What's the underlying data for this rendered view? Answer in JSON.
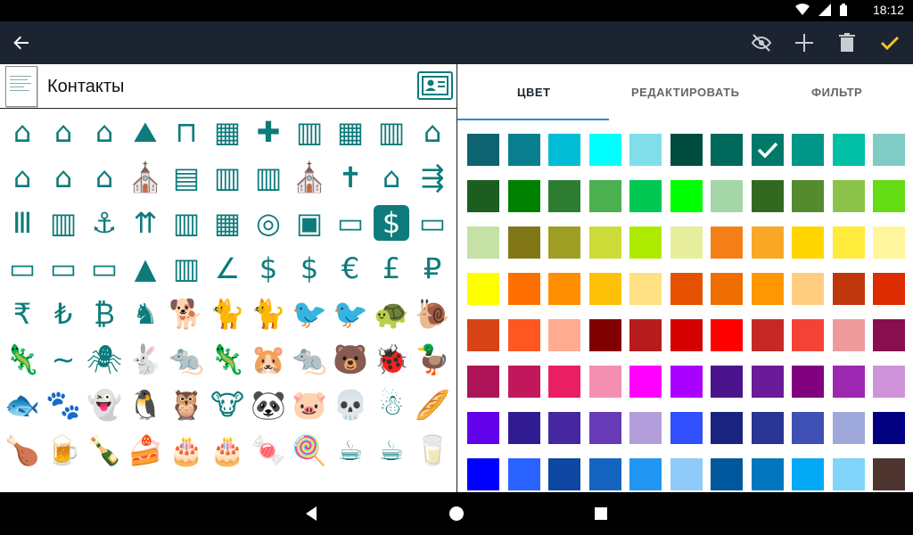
{
  "status_bar": {
    "time": "18:12"
  },
  "toolbar": {
    "back_icon": "arrow-back-icon",
    "actions": [
      "eye-off-icon",
      "plus-icon",
      "trash-icon",
      "check-icon"
    ],
    "check_color": "#f2c12e"
  },
  "left": {
    "title": "Контакты",
    "icon_color": "#0e7b7b",
    "icons": [
      "⌂",
      "⌂",
      "⌂",
      "⛰",
      "⊓",
      "▦",
      "✚",
      "▥",
      "▦",
      "▥",
      "⌂",
      "⌂",
      "⌂",
      "⌂",
      "⛪",
      "▤",
      "▥",
      "▥",
      "⛪",
      "✝",
      "⌂",
      "⇶",
      "Ⅲ",
      "▥",
      "⚓",
      "⇈",
      "▥",
      "▦",
      "◎",
      "▣",
      "▭",
      "$",
      "▭",
      "▭",
      "▭",
      "▭",
      "▲",
      "▥",
      "∠",
      "$",
      "$",
      "€",
      "£",
      "₽",
      "₹",
      "₺",
      "₿",
      "♞",
      "🐕",
      "🐈",
      "🐈",
      "🐦",
      "🐦",
      "🐢",
      "🐌",
      "🦎",
      "~",
      "🕷",
      "🐇",
      "🐀",
      "🦎",
      "🐹",
      "🐀",
      "🐻",
      "🐞",
      "🦆",
      "🐟",
      "🐾",
      "👻",
      "🐧",
      "🦉",
      "🐮",
      "🐼",
      "🐷",
      "💀",
      "☃",
      "🥖",
      "🍗",
      "🍺",
      "🍾",
      "🍰",
      "🎂",
      "🎂",
      "🍬",
      "🍭",
      "☕",
      "☕",
      "🥛"
    ],
    "selected_index": 31
  },
  "right": {
    "tabs": [
      {
        "label": "ЦВЕТ",
        "active": true
      },
      {
        "label": "РЕДАКТИРОВАТЬ",
        "active": false
      },
      {
        "label": "ФИЛЬТР",
        "active": false
      }
    ],
    "tab_indicator_color": "#2e8ad8",
    "selected_swatch_index": 7,
    "swatches": [
      "#0d6470",
      "#0a7f90",
      "#00bcd4",
      "#00ffff",
      "#80deea",
      "#004d40",
      "#00695c",
      "#00796b",
      "#009688",
      "#00bfa5",
      "#80cbc4",
      "#1b5e20",
      "#008000",
      "#2e7d32",
      "#4caf50",
      "#00c853",
      "#00ff00",
      "#a5d6a7",
      "#33691e",
      "#558b2f",
      "#8bc34a",
      "#64dd17",
      "#c5e1a5",
      "#827717",
      "#9e9d24",
      "#cddc39",
      "#aeea00",
      "#e6ee9c",
      "#f57f17",
      "#f9a825",
      "#ffd600",
      "#ffeb3b",
      "#fff59d",
      "#ffff00",
      "#ff6f00",
      "#ff8f00",
      "#ffc107",
      "#ffe082",
      "#e65100",
      "#ef6c00",
      "#ff9800",
      "#ffcc80",
      "#bf360c",
      "#dd2c00",
      "#d84315",
      "#ff5722",
      "#ffab91",
      "#800000",
      "#b71c1c",
      "#d50000",
      "#ff0000",
      "#c62828",
      "#f44336",
      "#ef9a9a",
      "#880e4f",
      "#ad1457",
      "#c2185b",
      "#e91e63",
      "#f48fb1",
      "#ff00ff",
      "#aa00ff",
      "#4a148c",
      "#6a1b9a",
      "#800080",
      "#9c27b0",
      "#ce93d8",
      "#6200ea",
      "#311b92",
      "#4527a0",
      "#673ab7",
      "#b39ddb",
      "#304ffe",
      "#1a237e",
      "#283593",
      "#3f51b5",
      "#9fa8da",
      "#000080",
      "#0000ff",
      "#2962ff",
      "#0d47a1",
      "#1565c0",
      "#2196f3",
      "#90caf9",
      "#01579b",
      "#0277bd",
      "#03a9f4",
      "#81d4fa",
      "#4e342e"
    ]
  }
}
